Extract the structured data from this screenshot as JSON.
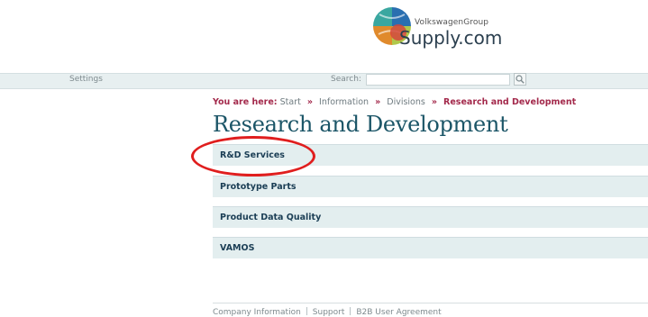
{
  "brand": {
    "group": "VolkswagenGroup",
    "name": "Supply.com"
  },
  "topbar": {
    "settings": "Settings",
    "search_label": "Search:",
    "search_value": ""
  },
  "breadcrumb": {
    "label": "You are here:",
    "items": [
      "Start",
      "Information",
      "Divisions",
      "Research and Development"
    ],
    "separator": "»"
  },
  "page_title": "Research and Development",
  "menu": {
    "items": [
      {
        "label": "R&D Services"
      },
      {
        "label": "Prototype Parts"
      },
      {
        "label": "Product Data Quality"
      },
      {
        "label": "VAMOS"
      }
    ]
  },
  "footer": {
    "links": [
      "Company Information",
      "Support",
      "B2B User Agreement"
    ]
  },
  "colors": {
    "accent": "#a3294b",
    "title": "#1b5567",
    "bar": "#e7eff0",
    "highlight": "#e01e1e"
  }
}
